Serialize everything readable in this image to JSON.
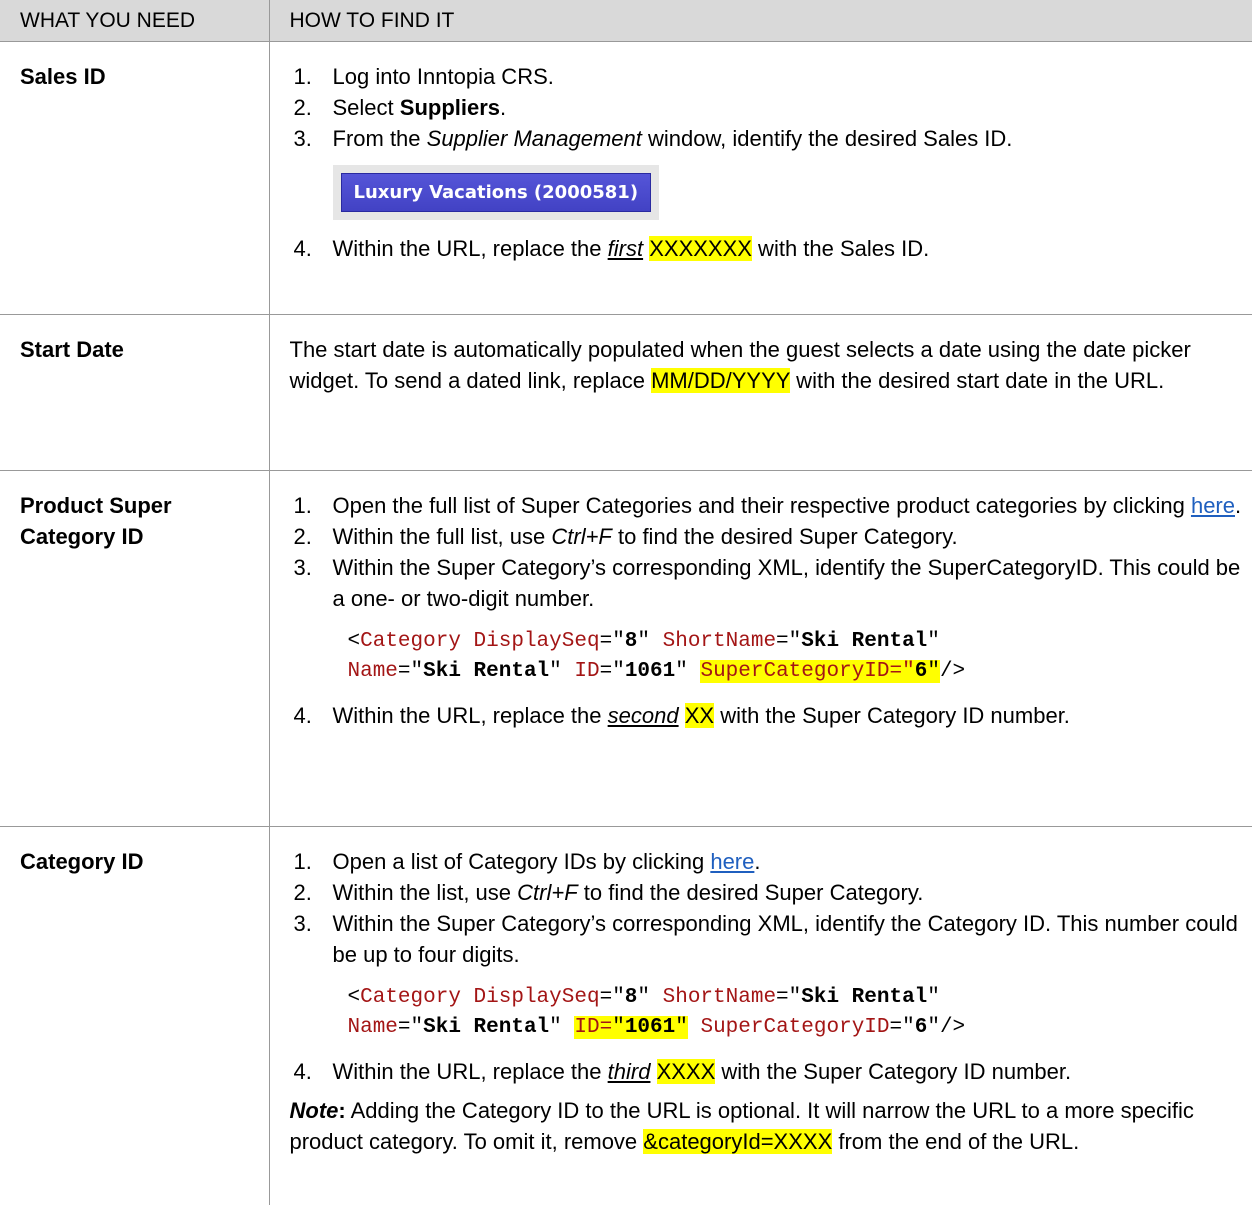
{
  "header": {
    "col1": "WHAT YOU NEED",
    "col2": "HOW TO FIND IT"
  },
  "rows": {
    "sales": {
      "label": "Sales ID",
      "s1": "Log into Inntopia CRS.",
      "s2_pre": "Select ",
      "s2_bold": "Suppliers",
      "s2_post": ".",
      "s3_pre": "From the ",
      "s3_em": "Supplier Management",
      "s3_post": " window, identify the desired Sales ID.",
      "badge": "Luxury Vacations (2000581)",
      "s4_pre": "Within the URL, replace the ",
      "s4_em": "first",
      "s4_mid": " ",
      "s4_hl": "XXXXXXX",
      "s4_post": " with the Sales ID."
    },
    "start": {
      "label": "Start Date",
      "text_pre": "The start date is automatically populated when the guest selects a date using the date picker widget. To send a dated link, replace ",
      "text_hl": "MM/DD/YYYY",
      "text_post": " with the desired start date in the URL."
    },
    "super": {
      "label": "Product Super Category ID",
      "s1_pre": "Open the full list of Super Categories and their respective product categories by clicking ",
      "s1_link": "here",
      "s1_post": ".",
      "s2_pre": "Within the full list, use ",
      "s2_em": "Ctrl+F",
      "s2_post": " to find the desired Super Category.",
      "s3": "Within the Super Category’s corresponding XML, identify the SuperCategoryID.  This could be a one- or two-digit number.",
      "s4_pre": "Within the URL, replace the ",
      "s4_em": "second",
      "s4_mid": " ",
      "s4_hl": "XX",
      "s4_post": " with the Super Category ID number."
    },
    "cat": {
      "label": "Category ID",
      "s1_pre": "Open a list of Category IDs by clicking ",
      "s1_link": "here",
      "s1_post": ".",
      "s2_pre": "Within the list, use ",
      "s2_em": "Ctrl+F",
      "s2_post": " to find the desired Super Category.",
      "s3": "Within the Super Category’s corresponding XML, identify the Category ID.  This number could be up to four digits.",
      "s4_pre": "Within the URL, replace the ",
      "s4_em": "third",
      "s4_mid": " ",
      "s4_hl": "XXXX",
      "s4_post": " with the Super Category ID number.",
      "note_label": "Note",
      "note_colon": ":",
      "note_text": " Adding the Category ID to the URL is optional.  It will narrow the URL to a more specific product category.  To omit it, remove ",
      "note_hl": "&categoryId=XXXX",
      "note_post": " from the end of the URL."
    }
  },
  "xml": {
    "lt": "<",
    "tag": "Category",
    "a1": "DisplaySeq",
    "v1": "8",
    "a2": "ShortName",
    "v2": "Ski Rental",
    "a3": "Name",
    "v3": "Ski Rental",
    "a4": "ID",
    "v4": "1061",
    "a5": "SuperCategoryID",
    "v5": "6",
    "end": "/>",
    "eq": "=",
    "q": "\""
  },
  "numbers": [
    "1.",
    "2.",
    "3.",
    "4."
  ]
}
